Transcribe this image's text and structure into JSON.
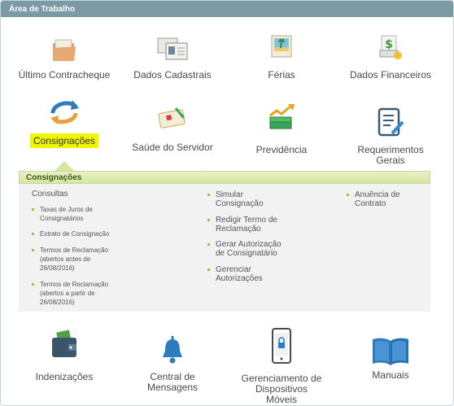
{
  "panel": {
    "title": "Área de Trabalho"
  },
  "tiles_row1": [
    {
      "label": "Último Contracheque",
      "icon": "folder-icon"
    },
    {
      "label": "Dados Cadastrais",
      "icon": "id-cards-icon"
    },
    {
      "label": "Férias",
      "icon": "vacation-postcard-icon"
    },
    {
      "label": "Dados Financeiros",
      "icon": "money-card-icon"
    }
  ],
  "tiles_row2": [
    {
      "label": "Consignações",
      "icon": "refresh-arrows-icon"
    },
    {
      "label": "Saúde do Servidor",
      "icon": "health-clipboard-icon"
    },
    {
      "label": "Previdência",
      "icon": "money-growth-icon"
    },
    {
      "label": "Requerimentos Gerais",
      "icon": "document-pen-icon"
    }
  ],
  "submenu": {
    "title": "Consignações",
    "col1": {
      "heading": "Consultas",
      "items": [
        "Taxas de Juros de Consignatários",
        "Extrato de Consignação",
        "Termos de Reclamação (abertos antes de 26/08/2016)",
        "Termos de Reclamação (abertos a partir de 26/08/2016)"
      ]
    },
    "col2": {
      "items": [
        "Simular Consignação",
        "Redigir Termo de Reclamação",
        "Gerar Autorização de Consignatário",
        "Gerenciar Autorizações"
      ]
    },
    "col3": {
      "items": [
        "Anuência de Contrato"
      ]
    }
  },
  "tiles_row3": [
    {
      "label": "Indenizações",
      "icon": "wallet-icon"
    },
    {
      "label": "Central de Mensagens",
      "icon": "bell-icon"
    },
    {
      "label": "Gerenciamento de Dispositivos Móveis",
      "icon": "mobile-lock-icon"
    },
    {
      "label": "Manuais",
      "icon": "book-icon"
    }
  ],
  "colors": {
    "header": "#7a9aa5",
    "highlight": "#f2f500",
    "bullet": "#9bc23c",
    "blue_icon": "#2e7bbf"
  }
}
